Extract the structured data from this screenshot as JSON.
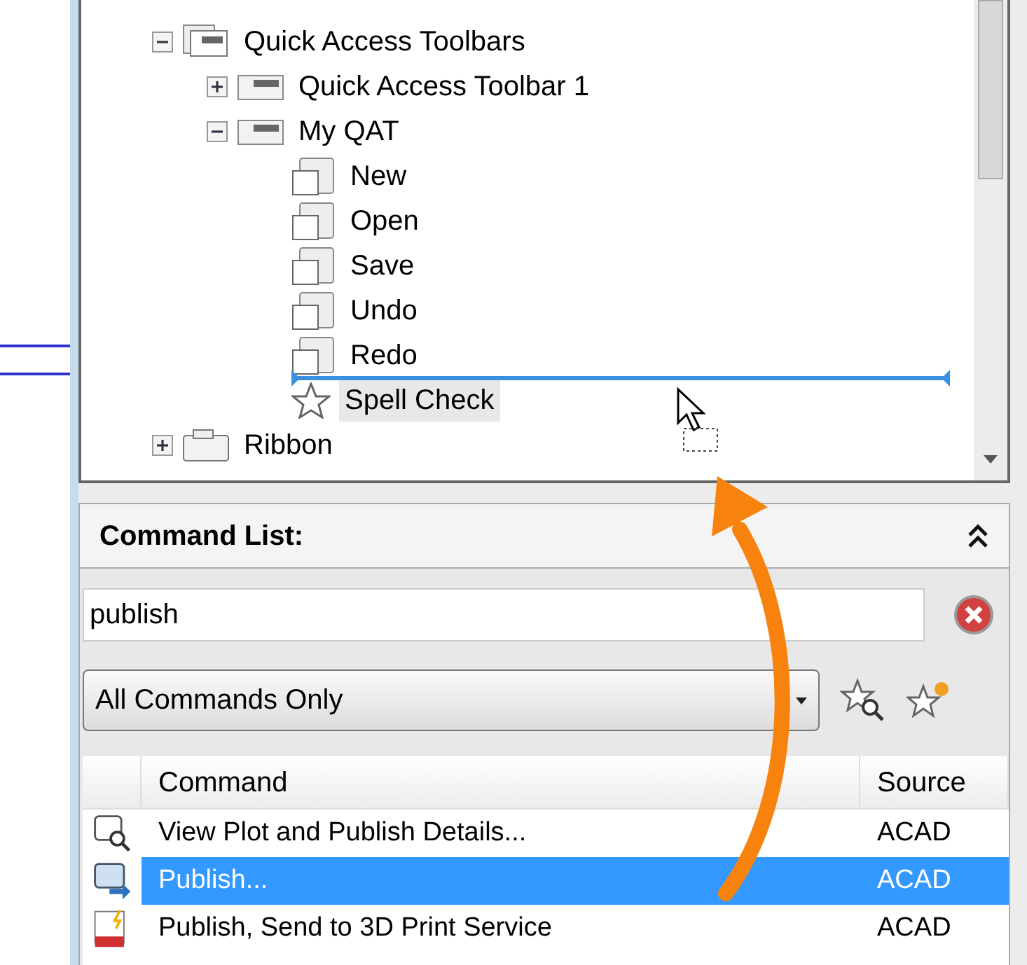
{
  "tree": [
    {
      "label": "Quick Access Toolbars",
      "kind": "group",
      "expanded": true,
      "selected": false,
      "children": [
        {
          "label": "Quick Access Toolbar 1",
          "kind": "toolbar",
          "expanded": false,
          "selected": false
        },
        {
          "label": "My QAT",
          "kind": "toolbar",
          "expanded": true,
          "selected": false,
          "children": [
            {
              "label": "New",
              "kind": "command",
              "selected": false
            },
            {
              "label": "Open",
              "kind": "command",
              "selected": false
            },
            {
              "label": "Save",
              "kind": "command",
              "selected": false
            },
            {
              "label": "Undo",
              "kind": "command",
              "selected": false
            },
            {
              "label": "Redo",
              "kind": "command",
              "selected": false
            },
            {
              "label": "Spell Check",
              "kind": "new_command",
              "selected": true
            }
          ]
        }
      ]
    },
    {
      "label": "Ribbon",
      "kind": "folder",
      "expanded": false,
      "selected": false
    }
  ],
  "command_list": {
    "title": "Command List:",
    "expanded": true,
    "search": {
      "value": "publish"
    },
    "filter": {
      "value": "All Commands Only"
    },
    "table": {
      "columns": [
        "Command",
        "Source"
      ],
      "rows": [
        {
          "kind": "details",
          "command": "View Plot and Publish Details...",
          "source": "ACAD",
          "selected": false
        },
        {
          "kind": "publish",
          "command": "Publish...",
          "source": "ACAD",
          "selected": true
        },
        {
          "kind": "print3d",
          "command": "Publish, Send to 3D Print Service",
          "source": "ACAD",
          "selected": false
        }
      ]
    }
  }
}
